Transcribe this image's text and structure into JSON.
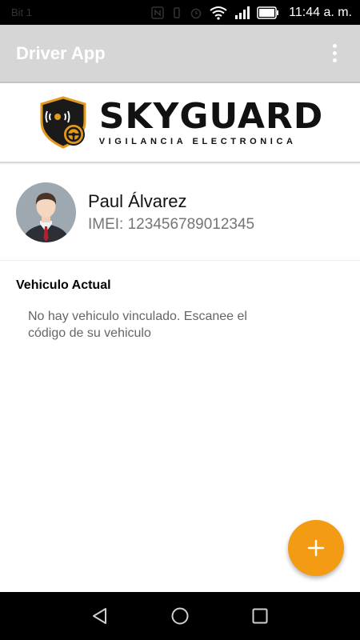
{
  "status_bar": {
    "left_label": "Bit 1",
    "signal_type": "4G",
    "time": "11:44 a. m.",
    "icons": [
      "nfc-icon",
      "vibrate-icon",
      "alarm-icon",
      "wifi-icon",
      "cell-signal-icon",
      "battery-icon"
    ]
  },
  "app_bar": {
    "title": "Driver App",
    "menu_icon": "overflow-menu-icon"
  },
  "banner": {
    "brand_name": "SKYGUARD",
    "tagline": "VIGILANCIA ELECTRONICA"
  },
  "profile": {
    "name": "Paul Álvarez",
    "imei_label": "IMEI: 123456789012345"
  },
  "vehicle": {
    "section_title": "Vehiculo Actual",
    "empty_message": "No hay vehiculo vinculado. Escanee el código de su vehiculo"
  },
  "fab": {
    "icon": "plus-icon"
  },
  "nav_bar": {
    "icons": [
      "back-icon",
      "home-icon",
      "recents-icon"
    ]
  },
  "colors": {
    "app_bar": "#d6d6d6",
    "accent": "#f39b12",
    "text_primary": "#111111",
    "text_secondary": "#757575"
  }
}
